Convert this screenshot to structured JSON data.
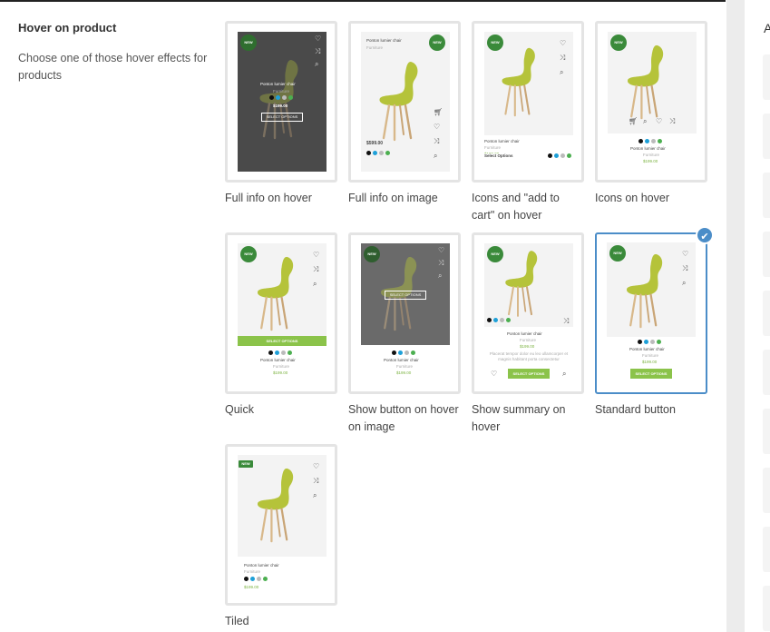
{
  "section": {
    "title": "Hover on product",
    "description": "Choose one of those hover effects for products"
  },
  "right_panel": {
    "letter": "A"
  },
  "product": {
    "name": "Ponton lumier chair",
    "category": "Furniture",
    "price": "$199.00",
    "price_alt": "$599.00",
    "badge": "NEW",
    "select_options": "SELECT OPTIONS",
    "select_options_title": "Select Options",
    "summary": "Placerat tempor dolor eu leo ullamcorper et magnis habitant porta consectetur"
  },
  "colors": {
    "accent": "#4b8dc8",
    "badge": "#3a8a3a",
    "button": "#8bc34a",
    "price": "#7cb342"
  },
  "options": [
    {
      "label": "Full info on hover",
      "selected": false
    },
    {
      "label": "Full info on image",
      "selected": false
    },
    {
      "label": "Icons and \"add to cart\" on hover",
      "selected": false
    },
    {
      "label": "Icons on hover",
      "selected": false
    },
    {
      "label": "Quick",
      "selected": false
    },
    {
      "label": "Show button on hover on image",
      "selected": false
    },
    {
      "label": "Show summary on hover",
      "selected": false
    },
    {
      "label": "Standard button",
      "selected": true
    },
    {
      "label": "Tiled",
      "selected": false
    }
  ],
  "icons": [
    "heart-icon",
    "shuffle-icon",
    "search-icon",
    "cart-icon",
    "checkmark-icon"
  ]
}
